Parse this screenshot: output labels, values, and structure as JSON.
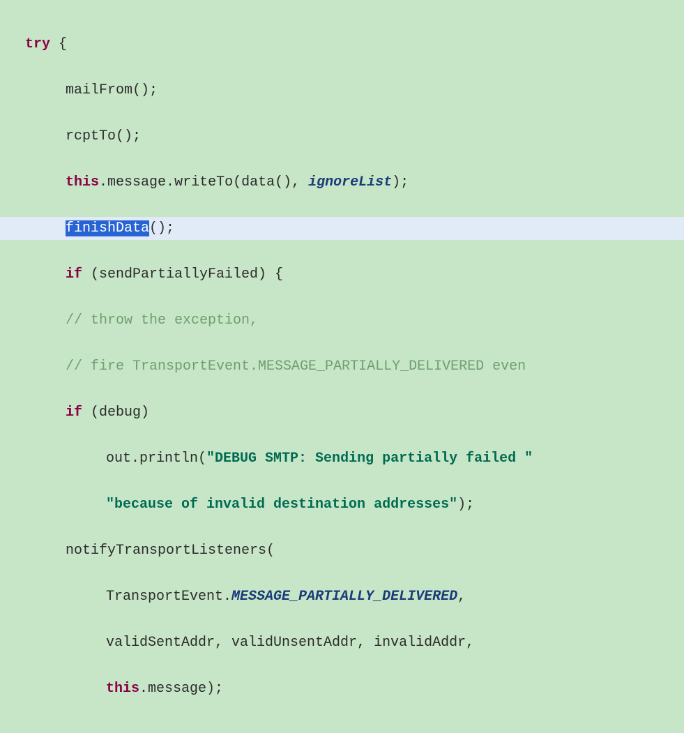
{
  "code": {
    "line1": {
      "kw": "try",
      "rest": " {"
    },
    "line2": {
      "call": "mailFrom();"
    },
    "line3": {
      "call": "rcptTo();"
    },
    "line4": {
      "this": "this",
      "dot1": ".",
      "prop": "message",
      "dot2": ".",
      "method": "writeTo(data(), ",
      "param": "ignoreList",
      "end": ");"
    },
    "line5": {
      "selected": "finishData",
      "rest": "();"
    },
    "line6": {
      "kw": "if",
      "cond": " (sendPartiallyFailed) {"
    },
    "line7": {
      "comment": "// throw the exception,"
    },
    "line8": {
      "comment": "// fire TransportEvent.MESSAGE_PARTIALLY_DELIVERED even"
    },
    "line9": {
      "kw": "if",
      "cond": " (debug)"
    },
    "line10": {
      "obj": "out.println(",
      "str": "\"DEBUG SMTP: Sending partially failed \""
    },
    "line11": {
      "str": "\"because of invalid destination addresses\"",
      "end": ");"
    },
    "line12": {
      "call": "notifyTransportListeners("
    },
    "line13": {
      "obj": "TransportEvent.",
      "const": "MESSAGE_PARTIALLY_DELIVERED",
      "end": ","
    },
    "line14": {
      "args": "validSentAddr, validUnsentAddr, invalidAddr,"
    },
    "line15": {
      "this": "this",
      "rest": ".message);"
    }
  }
}
